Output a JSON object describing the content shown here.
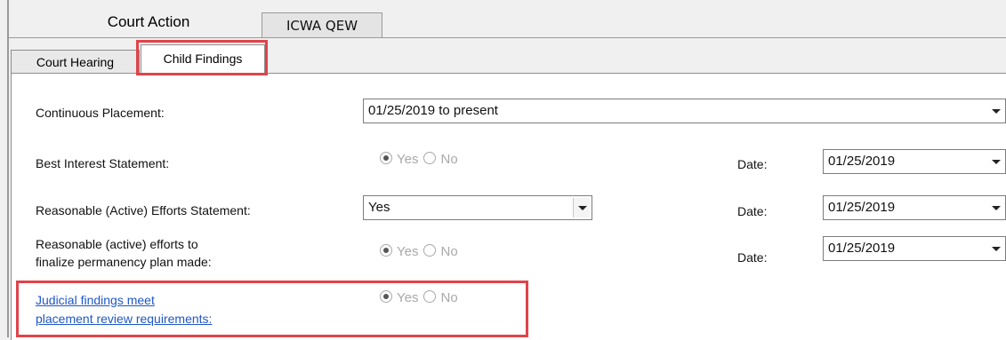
{
  "top_tabs": {
    "court_action": "Court Action",
    "icwa_qew": "ICWA QEW"
  },
  "inner_tabs": {
    "court_hearing": "Court Hearing",
    "child_findings": "Child Findings"
  },
  "fields": {
    "continuous_placement": {
      "label": "Continuous Placement:",
      "value": "01/25/2019 to present"
    },
    "best_interest": {
      "label": "Best Interest Statement:",
      "yes": "Yes",
      "no": "No",
      "selected": "Yes",
      "date_label": "Date:",
      "date": "01/25/2019"
    },
    "reasonable_efforts": {
      "label": "Reasonable (Active) Efforts Statement:",
      "value": "Yes",
      "date_label": "Date:",
      "date": "01/25/2019"
    },
    "permanency": {
      "label_line1": "Reasonable (active) efforts to",
      "label_line2": "finalize permanency plan made:",
      "yes": "Yes",
      "no": "No",
      "selected": "Yes",
      "date_label": "Date:",
      "date": "01/25/2019"
    },
    "judicial": {
      "label_line1": "Judicial findings meet",
      "label_line2": "placement review requirements:",
      "yes": "Yes",
      "no": "No",
      "selected": "Yes"
    }
  },
  "colors": {
    "highlight": "#e0434a",
    "link": "#1f56c9",
    "disabled_text": "#a9a9a9"
  },
  "icons": {
    "dropdown": "chevron-down-icon",
    "radio": "radio-button-icon"
  }
}
